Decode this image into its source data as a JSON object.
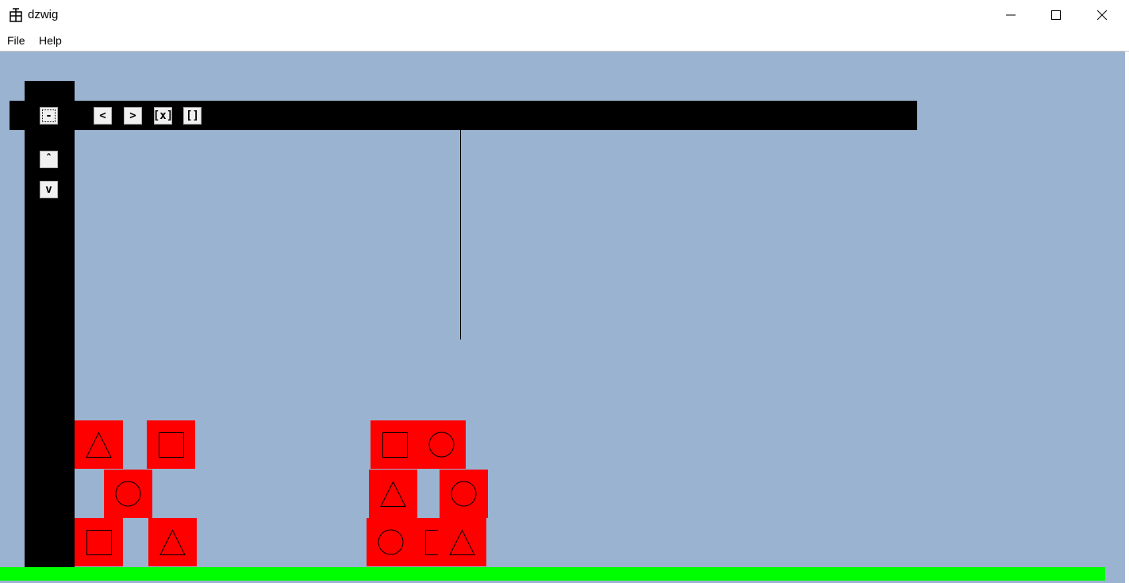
{
  "window": {
    "title": "dzwig",
    "icon": "app-icon"
  },
  "menu": {
    "file": "File",
    "help": "Help"
  },
  "controls": {
    "mode_label": "-",
    "left_label": "<",
    "right_label": ">",
    "grab_label": "[x]",
    "release_label": "[]",
    "up_label": "ˆ",
    "down_label": "v"
  },
  "colors": {
    "canvas": "#9ab3d0",
    "crane": "#000000",
    "ground": "#00ff00",
    "block": "#ff0000"
  },
  "blocks": [
    {
      "shape": "triangle"
    },
    {
      "shape": "square"
    },
    {
      "shape": "circle"
    },
    {
      "shape": "square"
    },
    {
      "shape": "triangle"
    },
    {
      "shape": "square"
    },
    {
      "shape": "circle"
    },
    {
      "shape": "triangle"
    },
    {
      "shape": "circle"
    },
    {
      "shape": "circle"
    },
    {
      "shape": "square"
    },
    {
      "shape": "triangle"
    }
  ]
}
